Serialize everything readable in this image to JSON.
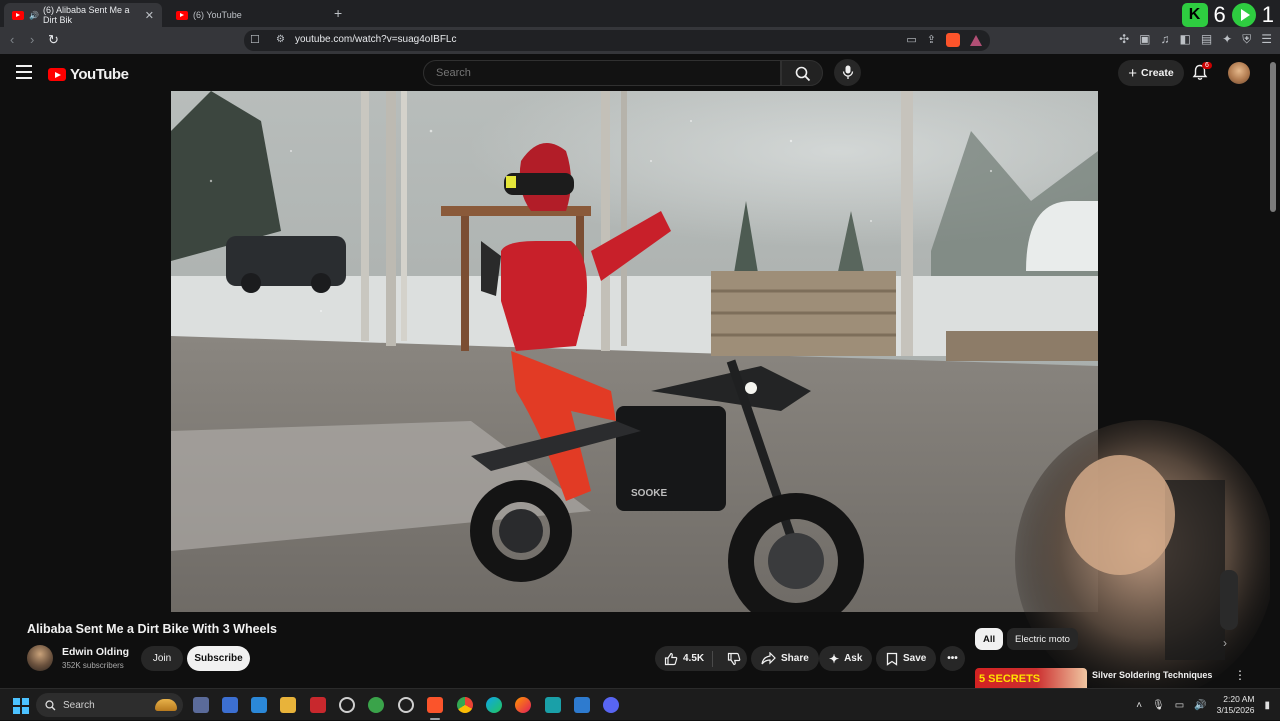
{
  "browser": {
    "tabs": [
      {
        "label": "(6) Alibaba Sent Me a Dirt Bik",
        "active": true
      },
      {
        "label": "(6) YouTube",
        "active": false
      }
    ],
    "new_tab": "+",
    "url": "youtube.com/watch?v=suag4oIBFLc",
    "top_right": {
      "count_a": "6",
      "count_b": "1"
    }
  },
  "youtube": {
    "logo_text": "YouTube",
    "search_placeholder": "Search",
    "create_label": "Create",
    "notification_count": "6"
  },
  "video": {
    "title": "Alibaba Sent Me a Dirt Bike With 3 Wheels",
    "channel": "Edwin Olding",
    "subscribers": "352K subscribers",
    "join_label": "Join",
    "subscribe_label": "Subscribe",
    "likes": "4.5K",
    "share_label": "Share",
    "ask_label": "Ask",
    "save_label": "Save",
    "bike_brand": "SOOKE"
  },
  "sidebar": {
    "chips": [
      "All",
      "Electric moto"
    ],
    "recommendation": {
      "thumb_text": "5 SECRETS",
      "title": "Silver Soldering Techniques"
    }
  },
  "taskbar": {
    "search_label": "Search",
    "time": "2:20 AM",
    "date": "3/15/2026"
  },
  "colors": {
    "yt_red": "#ff0000",
    "bg": "#0f0f0f",
    "chip_active": "#f1f1f1",
    "brave_orange": "#fb542b"
  }
}
